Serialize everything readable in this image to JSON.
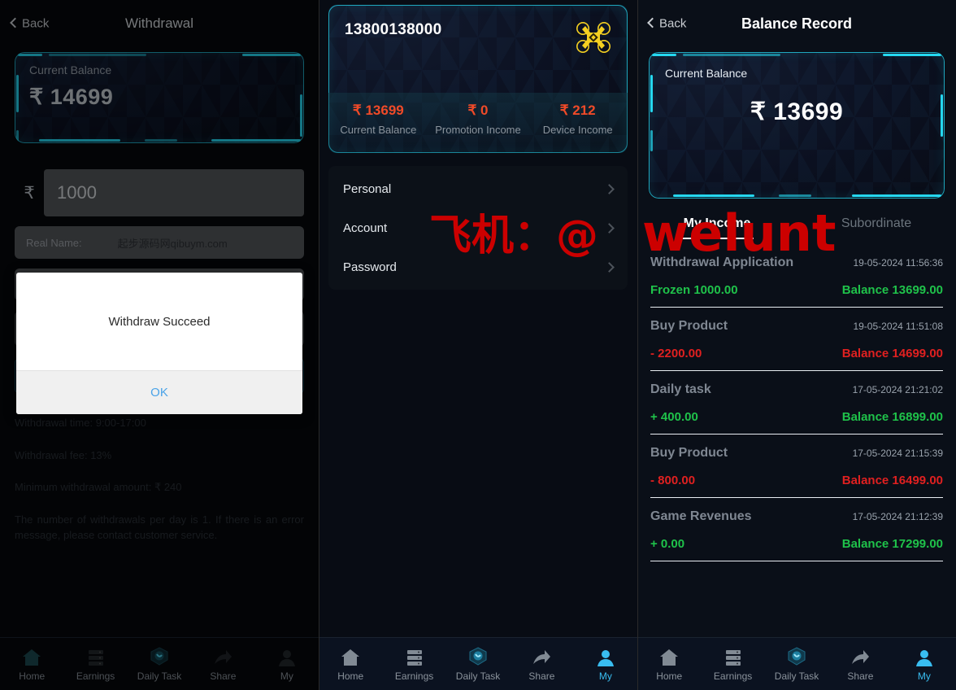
{
  "colors": {
    "accent_cyan": "#25d8f0",
    "accent_blue": "#39bdf0",
    "orange": "#f04a28",
    "green": "#1fc24a",
    "red": "#e02020",
    "drone_yellow": "#f5d021",
    "watermark_red": "#cc0000"
  },
  "watermark": {
    "part1": "飞机：@",
    "part2": "welunt"
  },
  "panel_withdrawal": {
    "header": {
      "back_label": "Back",
      "title": "Withdrawal"
    },
    "balance_card": {
      "label": "Current Balance",
      "currency": "₹",
      "amount": "14699"
    },
    "amount_input": {
      "currency_symbol": "₹",
      "value": "1000",
      "placeholder": "1000"
    },
    "real_name_field": {
      "label": "Real Name:",
      "value": "起步源码网qibuym.com"
    },
    "notes": [
      "Withdrawal time: 9:00-17:00",
      "Withdrawal fee: 13%",
      "Minimum withdrawal amount: ₹  240",
      "The number of withdrawals per day is 1. If there is an error message, please contact customer service."
    ],
    "modal": {
      "message": "Withdraw Succeed",
      "ok_label": "OK"
    },
    "nav": [
      {
        "label": "Home",
        "icon": "home-icon",
        "active": false
      },
      {
        "label": "Earnings",
        "icon": "server-icon",
        "active": false
      },
      {
        "label": "Daily Task",
        "icon": "task-shield-icon",
        "active": false
      },
      {
        "label": "Share",
        "icon": "share-arrow-icon",
        "active": false
      },
      {
        "label": "My",
        "icon": "person-icon",
        "active": false
      }
    ]
  },
  "panel_my": {
    "account": {
      "phone": "13800138000",
      "avatar_icon": "drone-icon"
    },
    "stats": [
      {
        "value": "₹ 13699",
        "label": "Current Balance"
      },
      {
        "value": "₹ 0",
        "label": "Promotion Income"
      },
      {
        "value": "₹ 212",
        "label": "Device Income"
      }
    ],
    "menu": [
      {
        "label": "Personal",
        "chevron": "chevron-right-icon"
      },
      {
        "label": "Account",
        "chevron": "chevron-right-icon"
      },
      {
        "label": "Password",
        "chevron": "chevron-right-icon"
      }
    ],
    "nav": [
      {
        "label": "Home",
        "icon": "home-icon",
        "active": false
      },
      {
        "label": "Earnings",
        "icon": "server-icon",
        "active": false
      },
      {
        "label": "Daily Task",
        "icon": "task-shield-icon",
        "active": false
      },
      {
        "label": "Share",
        "icon": "share-arrow-icon",
        "active": false
      },
      {
        "label": "My",
        "icon": "person-icon",
        "active": true
      }
    ]
  },
  "panel_record": {
    "header": {
      "back_label": "Back",
      "title": "Balance Record"
    },
    "balance_card": {
      "label": "Current Balance",
      "currency": "₹",
      "amount": "13699"
    },
    "tabs": [
      {
        "label": "My Income",
        "active": true
      },
      {
        "label": "Subordinate",
        "active": false
      }
    ],
    "records": [
      {
        "name": "Withdrawal Application",
        "time": "19-05-2024 11:56:36",
        "amount": "Frozen 1000.00",
        "balance": "Balance 13699.00",
        "sign": "pos"
      },
      {
        "name": "Buy Product",
        "time": "19-05-2024 11:51:08",
        "amount": "- 2200.00",
        "balance": "Balance 14699.00",
        "sign": "neg"
      },
      {
        "name": "Daily task",
        "time": "17-05-2024 21:21:02",
        "amount": "+ 400.00",
        "balance": "Balance 16899.00",
        "sign": "pos"
      },
      {
        "name": "Buy Product",
        "time": "17-05-2024 21:15:39",
        "amount": "- 800.00",
        "balance": "Balance 16499.00",
        "sign": "neg"
      },
      {
        "name": "Game Revenues",
        "time": "17-05-2024 21:12:39",
        "amount": "+ 0.00",
        "balance": "Balance 17299.00",
        "sign": "pos"
      }
    ],
    "nav": [
      {
        "label": "Home",
        "icon": "home-icon",
        "active": false
      },
      {
        "label": "Earnings",
        "icon": "server-icon",
        "active": false
      },
      {
        "label": "Daily Task",
        "icon": "task-shield-icon",
        "active": false
      },
      {
        "label": "Share",
        "icon": "share-arrow-icon",
        "active": false
      },
      {
        "label": "My",
        "icon": "person-icon",
        "active": true
      }
    ]
  }
}
